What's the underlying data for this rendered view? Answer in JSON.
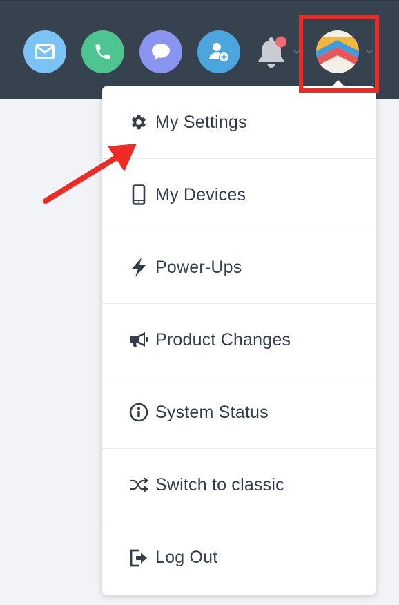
{
  "colors": {
    "topbar": "#36434f",
    "email": "#7cc3f5",
    "phone": "#4ec491",
    "chat": "#8a95f2",
    "add_contact": "#4ba6dd",
    "notification_dot": "#f06a74",
    "highlight": "#ee2a22",
    "menu_text": "#333c47"
  },
  "header": {
    "buttons": [
      {
        "icon": "envelope-icon"
      },
      {
        "icon": "phone-icon"
      },
      {
        "icon": "chat-bubble-icon"
      },
      {
        "icon": "add-contact-icon"
      },
      {
        "icon": "bell-icon",
        "has_notification": true
      },
      {
        "icon": "avatar",
        "highlighted": true
      }
    ]
  },
  "menu": {
    "items": [
      {
        "label": "My Settings",
        "icon": "gear-icon"
      },
      {
        "label": "My Devices",
        "icon": "mobile-phone-icon"
      },
      {
        "label": "Power-Ups",
        "icon": "lightning-bolt-icon"
      },
      {
        "label": "Product Changes",
        "icon": "megaphone-icon"
      },
      {
        "label": "System Status",
        "icon": "info-circle-icon"
      },
      {
        "label": "Switch to classic",
        "icon": "shuffle-icon"
      },
      {
        "label": "Log Out",
        "icon": "sign-out-icon"
      }
    ]
  }
}
